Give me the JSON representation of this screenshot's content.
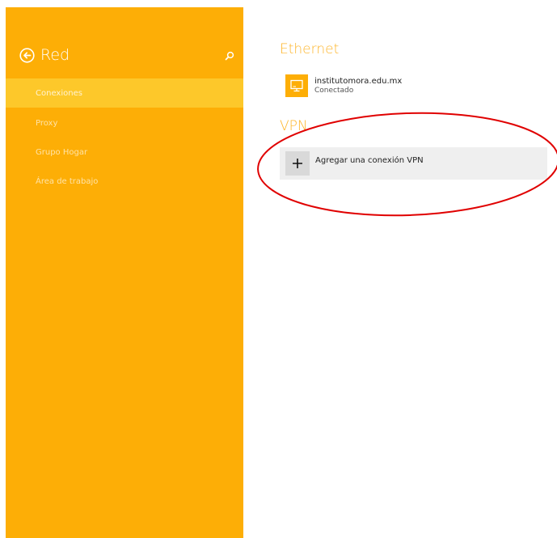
{
  "sidebar": {
    "title": "Red",
    "back_icon": "back-arrow-circle-icon",
    "search_icon": "search-icon",
    "items": [
      {
        "label": "Conexiones",
        "selected": true
      },
      {
        "label": "Proxy",
        "selected": false
      },
      {
        "label": "Grupo Hogar",
        "selected": false
      },
      {
        "label": "Área de trabajo",
        "selected": false
      }
    ]
  },
  "ethernet": {
    "title": "Ethernet",
    "icon": "network-monitor-icon",
    "connection": {
      "name": "institutomora.edu.mx",
      "status": "Conectado"
    }
  },
  "vpn": {
    "title": "VPN",
    "add_icon": "plus-icon",
    "add_label": "Agregar una conexión VPN"
  },
  "colors": {
    "sidebar_bg": "#FDAE06",
    "selected_item_bg": "#FDC82A",
    "accent_text": "#FDB52A",
    "annotation_ellipse": "#E00000"
  }
}
